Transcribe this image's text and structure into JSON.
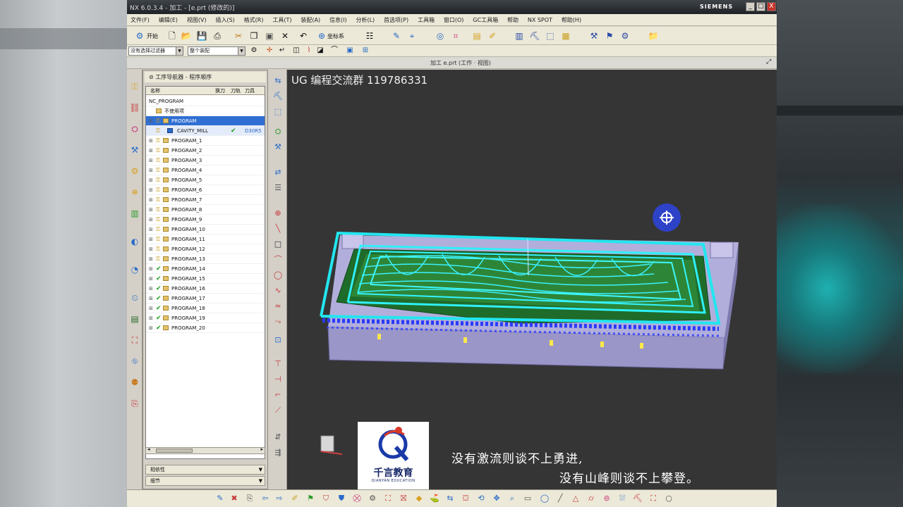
{
  "window": {
    "title": "NX 6.0.3.4 - 加工 - [e.prt (修改的)]",
    "brand": "SIEMENS",
    "controls": [
      "_",
      "□",
      "X"
    ]
  },
  "menu": [
    "文件(F)",
    "编辑(E)",
    "视图(V)",
    "插入(S)",
    "格式(R)",
    "工具(T)",
    "装配(A)",
    "信息(I)",
    "分析(L)",
    "首选项(P)",
    "工具箱",
    "窗口(O)",
    "GC工具箱",
    "帮助",
    "NX SPOT",
    "帮助(H)"
  ],
  "toolbar": {
    "start_label": "开始",
    "wcs_label": "坐标系",
    "filter_combo": "没有选择过滤器",
    "assembly_combo": "整个装配"
  },
  "view_title": "加工 e.prt (工作 · 视图)",
  "navigator": {
    "title": "工序导航器 - 程序顺序",
    "columns": [
      "名称",
      "换刀",
      "刀轨",
      "刀具"
    ],
    "root": "NC_PROGRAM",
    "unused": "不使用项",
    "rows": [
      {
        "label": "PROGRAM",
        "state": "selected",
        "icon": "key"
      },
      {
        "label": "CAVITY_MILL",
        "state": "active",
        "icon": "key",
        "mark": "✔",
        "tool": "D30R5"
      },
      {
        "label": "PROGRAM_1",
        "state": "normal",
        "icon": "key"
      },
      {
        "label": "PROGRAM_2",
        "state": "normal",
        "icon": "key"
      },
      {
        "label": "PROGRAM_3",
        "state": "normal",
        "icon": "key"
      },
      {
        "label": "PROGRAM_4",
        "state": "normal",
        "icon": "key"
      },
      {
        "label": "PROGRAM_5",
        "state": "normal",
        "icon": "key"
      },
      {
        "label": "PROGRAM_6",
        "state": "normal",
        "icon": "key"
      },
      {
        "label": "PROGRAM_7",
        "state": "normal",
        "icon": "key"
      },
      {
        "label": "PROGRAM_8",
        "state": "normal",
        "icon": "key"
      },
      {
        "label": "PROGRAM_9",
        "state": "normal",
        "icon": "key"
      },
      {
        "label": "PROGRAM_10",
        "state": "normal",
        "icon": "key"
      },
      {
        "label": "PROGRAM_11",
        "state": "normal",
        "icon": "key"
      },
      {
        "label": "PROGRAM_12",
        "state": "normal",
        "icon": "key"
      },
      {
        "label": "PROGRAM_13",
        "state": "normal",
        "icon": "key"
      },
      {
        "label": "PROGRAM_14",
        "state": "normal",
        "icon": "check"
      },
      {
        "label": "PROGRAM_15",
        "state": "normal",
        "icon": "check"
      },
      {
        "label": "PROGRAM_16",
        "state": "normal",
        "icon": "check"
      },
      {
        "label": "PROGRAM_17",
        "state": "normal",
        "icon": "check"
      },
      {
        "label": "PROGRAM_18",
        "state": "normal",
        "icon": "check"
      },
      {
        "label": "PROGRAM_19",
        "state": "normal",
        "icon": "check"
      },
      {
        "label": "PROGRAM_20",
        "state": "normal",
        "icon": "check"
      }
    ],
    "panels": [
      "相依性",
      "细节"
    ]
  },
  "viewport": {
    "watermark": "UG 编程交流群 119786331",
    "logo_text": "千言教育",
    "logo_sub": "QIANYAN EDUCATION",
    "caption_line1": "没有激流则谈不上勇进,",
    "caption_line2": "没有山峰则谈不上攀登。"
  }
}
